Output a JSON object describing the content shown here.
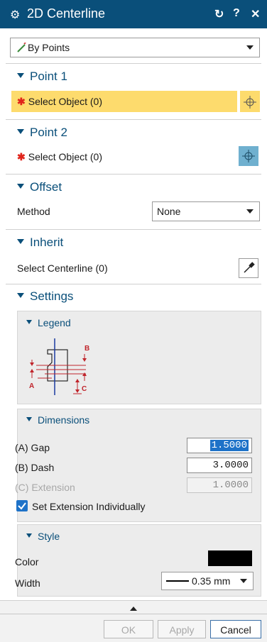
{
  "window": {
    "title": "2D Centerline",
    "reset_glyph": "↻",
    "help_glyph": "?",
    "close_glyph": "✕"
  },
  "type_select": {
    "value": "By Points"
  },
  "point1": {
    "heading": "Point 1",
    "select_label": "Select Object (0)"
  },
  "point2": {
    "heading": "Point 2",
    "select_label": "Select Object (0)"
  },
  "offset": {
    "heading": "Offset",
    "method_label": "Method",
    "method_value": "None"
  },
  "inherit": {
    "heading": "Inherit",
    "select_label": "Select Centerline (0)"
  },
  "settings": {
    "heading": "Settings",
    "legend": {
      "heading": "Legend",
      "labels": {
        "a": "A",
        "b": "B",
        "c": "C"
      }
    },
    "dimensions": {
      "heading": "Dimensions",
      "gap_label": "(A) Gap",
      "gap_value": "1.5000",
      "dash_label": "(B) Dash",
      "dash_value": "3.0000",
      "extension_label": "(C) Extension",
      "extension_value": "1.0000",
      "set_extension_label": "Set Extension Individually",
      "set_extension_checked": true
    },
    "style": {
      "heading": "Style",
      "color_label": "Color",
      "color_value": "#000000",
      "width_label": "Width",
      "width_value": "0.35 mm"
    }
  },
  "footer": {
    "ok": "OK",
    "apply": "Apply",
    "cancel": "Cancel"
  },
  "colors": {
    "title_bar": "#0a4f7a",
    "highlight_row": "#fddb6d",
    "active_select": "#6fb0cf",
    "required_star": "#e0241b",
    "gap_selection": "#1e72c8"
  },
  "icons": {
    "title": "gear-icon",
    "type": "line-pencil-icon",
    "selector": "crosshair-icon",
    "inherit": "eyedropper-icon"
  }
}
